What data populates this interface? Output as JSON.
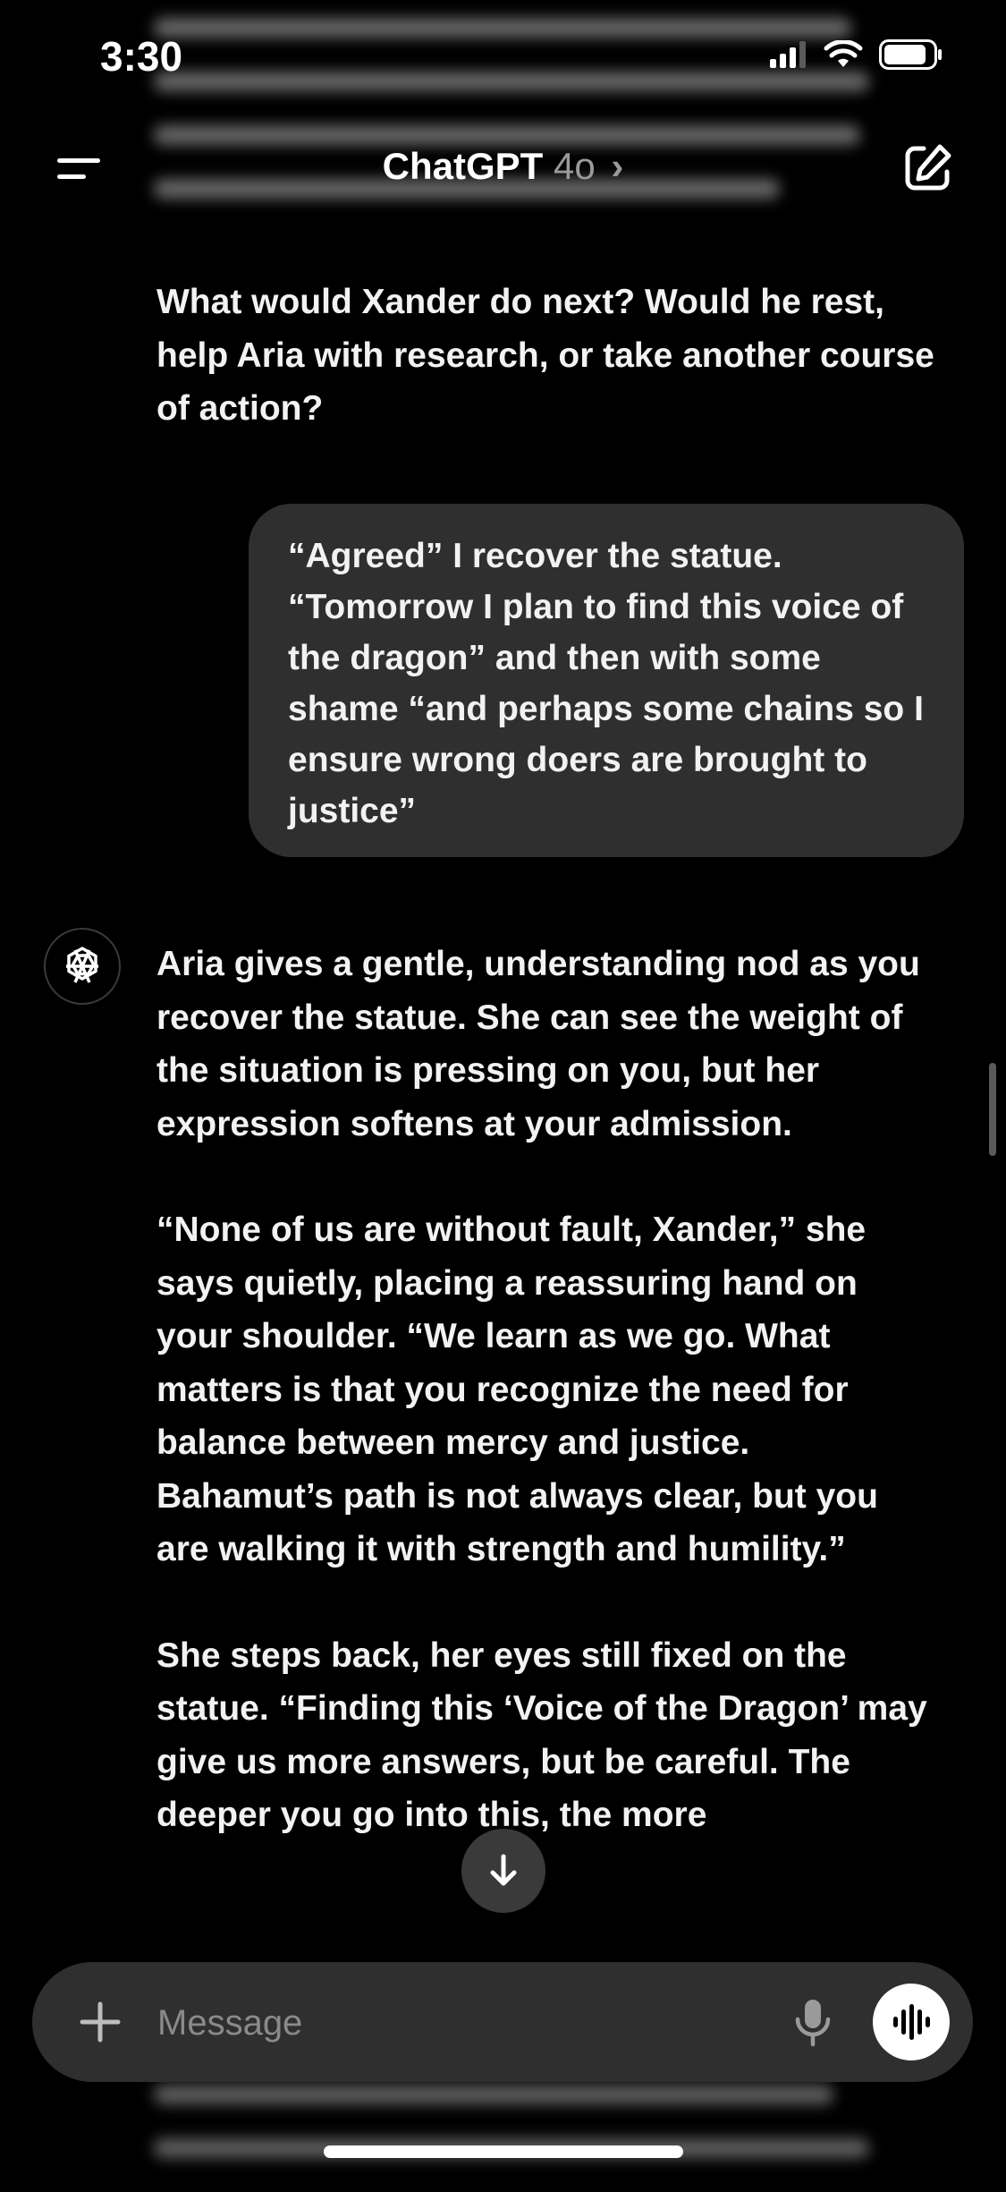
{
  "status": {
    "time": "3:30"
  },
  "nav": {
    "title": "ChatGPT",
    "model": "4o",
    "chevron": "›"
  },
  "messages": {
    "assistant_top": "What would Xander do next? Would he rest, help Aria with research, or take another course of action?",
    "user_message": "“Agreed” I recover the statue. “Tomorrow I plan to find this voice of the dragon” and then with some shame “and perhaps some chains so I ensure wrong doers are brought to justice”",
    "assistant_reply": [
      "Aria gives a gentle, understanding nod as you recover the statue. She can see the weight of the situation is pressing on you, but her expression softens at your admission.",
      "“None of us are without fault, Xander,” she says quietly, placing a reassuring hand on your shoulder. “We learn as we go. What matters is that you recognize the need for balance between mercy and justice. Bahamut’s path is not always clear, but you are walking it with strength and humility.”",
      "She steps back, her eyes still fixed on the statue. “Finding this ‘Voice of the Dragon’ may give us more answers, but be careful. The deeper you go into this, the more"
    ]
  },
  "composer": {
    "placeholder": "Message"
  },
  "icons": {
    "menu": "menu-icon",
    "compose": "compose-icon",
    "assistant": "openai-logo-icon",
    "scroll": "arrow-down-icon",
    "plus": "plus-icon",
    "mic": "mic-icon",
    "voice": "voice-waveform-icon"
  },
  "colors": {
    "background": "#000000",
    "bubble": "#2f2f2f",
    "composer": "#2f2f2f",
    "muted": "#9a9a9a"
  }
}
